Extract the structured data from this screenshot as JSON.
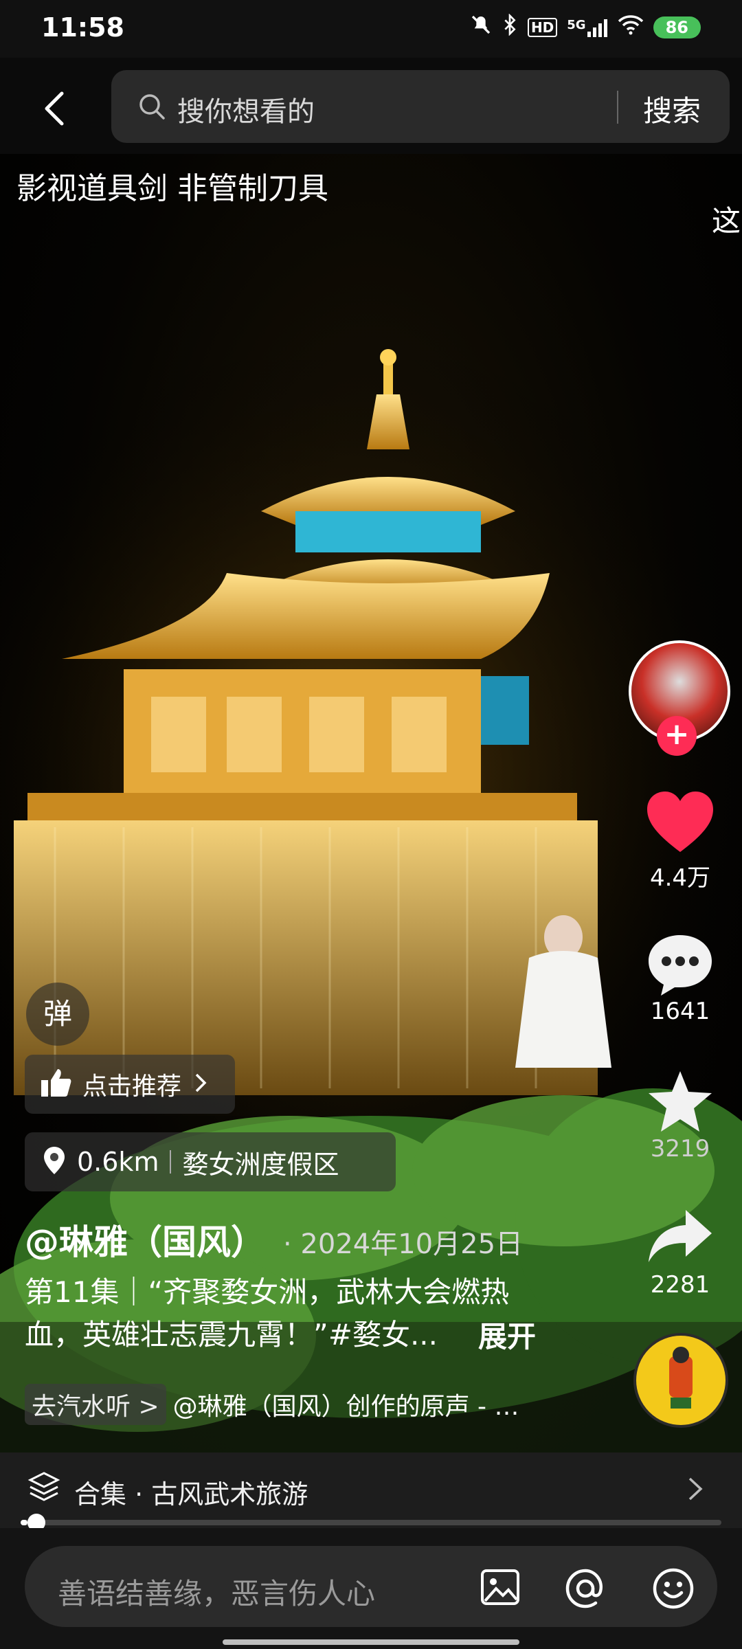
{
  "status_bar": {
    "time": "11:58",
    "network": "5G",
    "hd_label": "HD",
    "battery": "86"
  },
  "search": {
    "placeholder": "搜你想看的",
    "button_label": "搜索"
  },
  "video": {
    "caption": "影视道具剑 非管制刀具",
    "side_hint": "这"
  },
  "actions": {
    "likes": "4.4万",
    "comments": "1641",
    "favorites": "3219",
    "shares": "2281"
  },
  "overlay": {
    "danmu_label": "弹",
    "recommend_label": "点击推荐",
    "distance": "0.6km",
    "location_name": "婺女洲度假区",
    "author": "@琳雅（国风）",
    "date": "· 2024年10月25日",
    "description": "第11集｜“齐聚婺女洲，武林大会燃热血，英雄壮志震九霄！”#婺女...",
    "expand_label": "展开",
    "music_tag": "去汽水听 >",
    "music_text": "@琳雅（国风）创作的原声 - …"
  },
  "collection": {
    "label": "合集 · 古风武术旅游",
    "progress_fraction": 0.01
  },
  "comment": {
    "placeholder": "善语结善缘，恶言伤人心"
  },
  "colors": {
    "like": "#fe2c55",
    "follow": "#fe2c55",
    "battery": "#48c05a",
    "music_disc": "#f3c91a"
  }
}
